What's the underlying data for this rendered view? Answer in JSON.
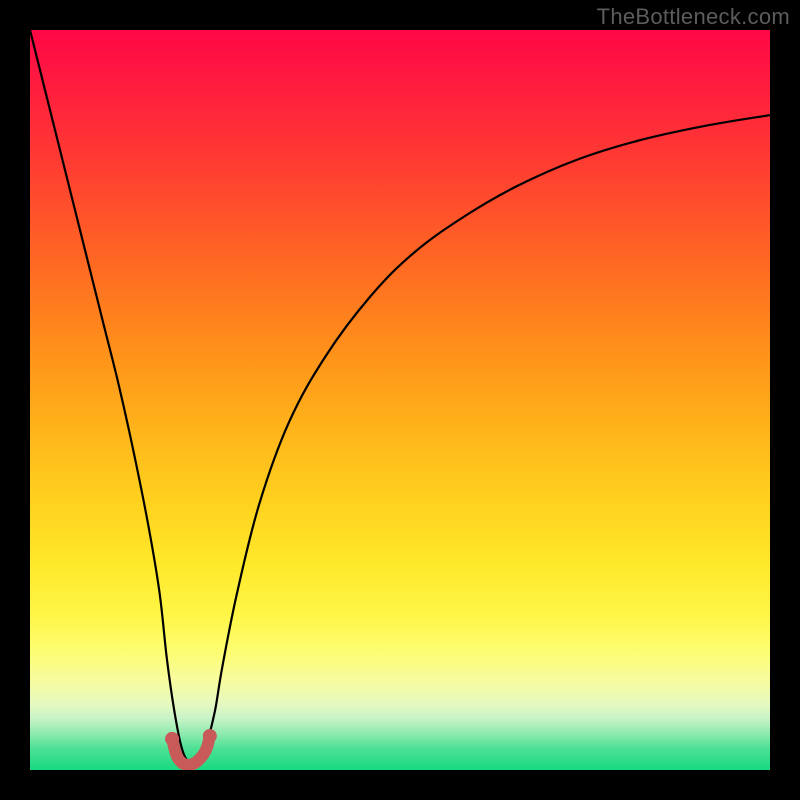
{
  "watermark": "TheBottleneck.com",
  "chart_data": {
    "type": "line",
    "title": "",
    "xlabel": "",
    "ylabel": "",
    "xlim": [
      0,
      100
    ],
    "ylim": [
      0,
      100
    ],
    "grid": false,
    "legend": false,
    "series": [
      {
        "name": "curve",
        "x": [
          0,
          2,
          4,
          6,
          8,
          10,
          12,
          14,
          16,
          17.5,
          18.5,
          19.5,
          20.5,
          21.5,
          22.5,
          23.2,
          24,
          25,
          26,
          28,
          31,
          35,
          40,
          46,
          52,
          59,
          66,
          74,
          82,
          91,
          100
        ],
        "y": [
          100,
          92,
          84,
          76,
          68,
          60,
          52,
          43,
          33,
          24,
          15,
          8,
          3,
          1,
          1,
          2,
          4,
          8,
          14,
          24,
          36,
          47,
          56,
          64,
          70,
          75,
          79,
          82.5,
          85,
          87,
          88.5
        ]
      },
      {
        "name": "trough-marker",
        "x": [
          19.2,
          19.8,
          20.5,
          21.3,
          22.2,
          23.2,
          23.9,
          24.3
        ],
        "y": [
          4.2,
          2.0,
          1.0,
          0.7,
          0.9,
          1.8,
          3.0,
          4.6
        ]
      }
    ],
    "marker_color": "#c85a5a",
    "line_color": "#000000"
  }
}
